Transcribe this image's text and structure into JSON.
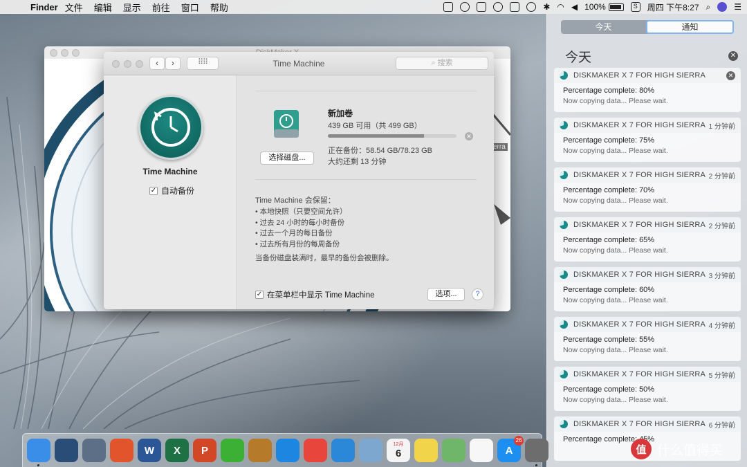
{
  "menubar": {
    "apple_glyph": "",
    "app_name": "Finder",
    "menus": [
      "文件",
      "编辑",
      "显示",
      "前往",
      "窗口",
      "帮助"
    ],
    "battery": "100%",
    "clock": "周四 下午8:27"
  },
  "notification_center": {
    "tabs": [
      "今天",
      "通知"
    ],
    "active_tab": "通知",
    "section_title": "今天",
    "notifications": [
      {
        "app": "DISKMAKER X 7 FOR HIGH SIERRA",
        "time": "",
        "title": "Percentage complete: 80%",
        "body": "Now copying data... Please wait."
      },
      {
        "app": "DISKMAKER X 7 FOR HIGH SIERRA",
        "time": "1 分钟前",
        "title": "Percentage complete: 75%",
        "body": "Now copying data... Please wait."
      },
      {
        "app": "DISKMAKER X 7 FOR HIGH SIERRA",
        "time": "2 分钟前",
        "title": "Percentage complete: 70%",
        "body": "Now copying data... Please wait."
      },
      {
        "app": "DISKMAKER X 7 FOR HIGH SIERRA",
        "time": "2 分钟前",
        "title": "Percentage complete: 65%",
        "body": "Now copying data... Please wait."
      },
      {
        "app": "DISKMAKER X 7 FOR HIGH SIERRA",
        "time": "3 分钟前",
        "title": "Percentage complete: 60%",
        "body": "Now copying data... Please wait."
      },
      {
        "app": "DISKMAKER X 7 FOR HIGH SIERRA",
        "time": "4 分钟前",
        "title": "Percentage complete: 55%",
        "body": "Now copying data... Please wait."
      },
      {
        "app": "DISKMAKER X 7 FOR HIGH SIERRA",
        "time": "5 分钟前",
        "title": "Percentage complete: 50%",
        "body": "Now copying data... Please wait."
      },
      {
        "app": "DISKMAKER X 7 FOR HIGH SIERRA",
        "time": "6 分钟前",
        "title": "Percentage complete: 45%",
        "body": ""
      }
    ]
  },
  "diskmaker_window": {
    "title": "DiskMaker X",
    "tag_text": "erra"
  },
  "time_machine": {
    "window_title": "Time Machine",
    "search_placeholder": "搜索",
    "app_label": "Time Machine",
    "auto_backup_label": "自动备份",
    "auto_backup_checked": true,
    "disk": {
      "name": "新加卷",
      "availability": "439 GB 可用（共 499 GB）",
      "select_button": "选择磁盘...",
      "backup_status": "正在备份：58.54 GB/78.23 GB",
      "remaining": "大约还剩 13 分钟",
      "progress": 0.748
    },
    "keeps_title": "Time Machine 会保留：",
    "keeps": [
      "本地快照（只要空间允许）",
      "过去 24 小时的每小时备份",
      "过去一个月的每日备份",
      "过去所有月份的每周备份"
    ],
    "full_note": "当备份磁盘装满时，最早的备份会被删除。",
    "menu_option_label": "在菜单栏中显示 Time Machine",
    "menu_option_checked": true,
    "options_button": "选项...",
    "help_button": "?"
  },
  "dock": {
    "items": [
      {
        "name": "finder",
        "color": "#3b8ee8",
        "glyph": "",
        "running": true
      },
      {
        "name": "mission-control",
        "color": "#2a4d78",
        "glyph": ""
      },
      {
        "name": "launchpad",
        "color": "#5c6f86",
        "glyph": ""
      },
      {
        "name": "lark",
        "color": "#e2552c",
        "glyph": ""
      },
      {
        "name": "word",
        "color": "#2b5797",
        "glyph": "W"
      },
      {
        "name": "excel",
        "color": "#1e7145",
        "glyph": "X"
      },
      {
        "name": "powerpoint",
        "color": "#d24726",
        "glyph": "P"
      },
      {
        "name": "wechat",
        "color": "#3cb034",
        "glyph": ""
      },
      {
        "name": "acorn",
        "color": "#b57a2a",
        "glyph": ""
      },
      {
        "name": "safari",
        "color": "#1c86e0",
        "glyph": ""
      },
      {
        "name": "chrome",
        "color": "#e8453c",
        "glyph": ""
      },
      {
        "name": "edge",
        "color": "#2b88d8",
        "glyph": ""
      },
      {
        "name": "preview",
        "color": "#7da7cf",
        "glyph": ""
      },
      {
        "name": "calendar",
        "color": "#f4f4f4",
        "glyph": "6",
        "subtitle": "12月"
      },
      {
        "name": "notes",
        "color": "#f2d44a",
        "glyph": ""
      },
      {
        "name": "maps",
        "color": "#6fb56a",
        "glyph": ""
      },
      {
        "name": "photos",
        "color": "#f7f7f7",
        "glyph": ""
      },
      {
        "name": "app-store",
        "color": "#1d8ff0",
        "glyph": "A",
        "badge": "26"
      },
      {
        "name": "system-preferences",
        "color": "#6d6d6d",
        "glyph": "",
        "running": true
      }
    ]
  },
  "watermark": {
    "logo_glyph": "值",
    "text": "什么值得买"
  }
}
